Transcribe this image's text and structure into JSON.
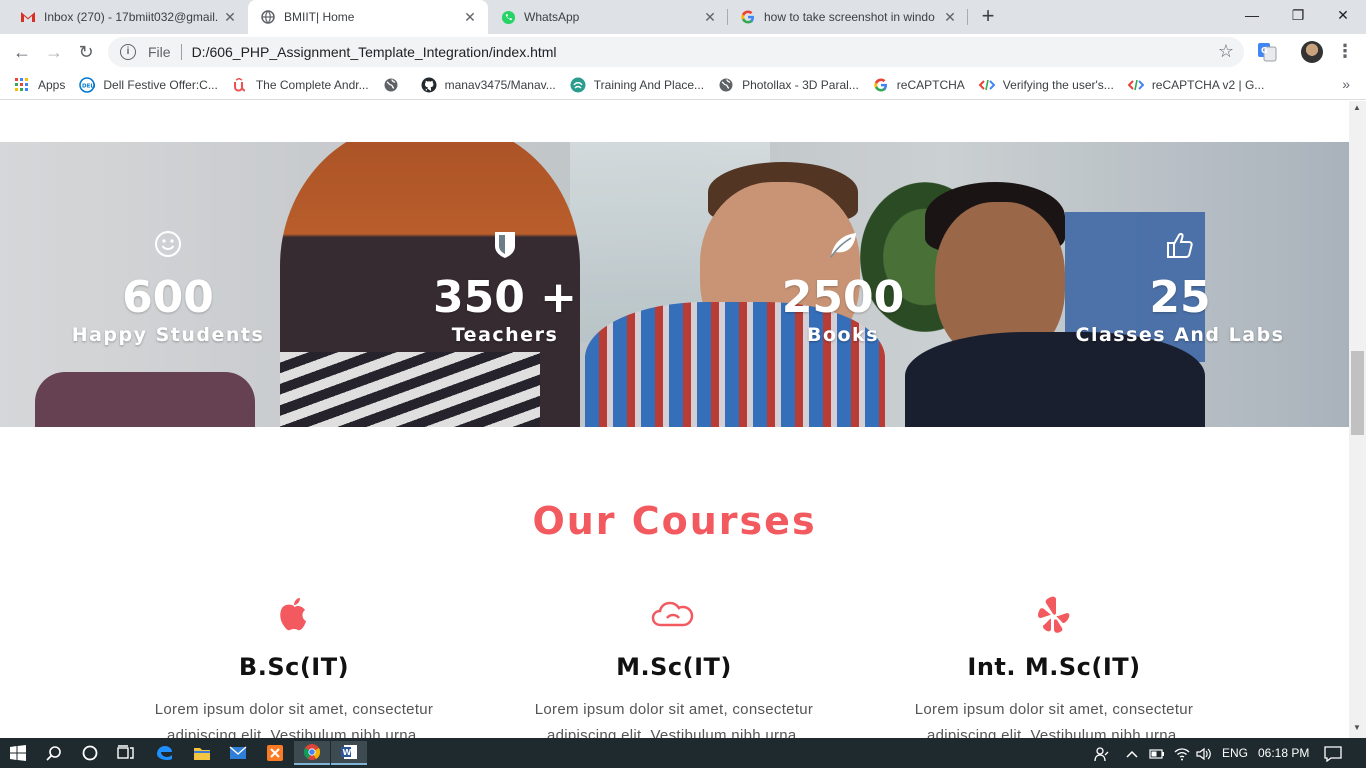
{
  "browser": {
    "tabs": [
      {
        "title": "Inbox (270) - 17bmiit032@gmail.",
        "favicon": "gmail-icon"
      },
      {
        "title": "BMIIT| Home",
        "favicon": "globe-icon",
        "active": true
      },
      {
        "title": "WhatsApp",
        "favicon": "whatsapp-icon"
      },
      {
        "title": "how to take screenshot in windo",
        "favicon": "google-icon"
      }
    ],
    "new_tab": "+",
    "url_scheme": "File",
    "url": "D:/606_PHP_Assignment_Template_Integration/index.html"
  },
  "bookmarks": [
    {
      "label": "Apps",
      "icon": "apps-grid-icon"
    },
    {
      "label": "Dell Festive Offer:C...",
      "icon": "dell-icon"
    },
    {
      "label": "The Complete Andr...",
      "icon": "udemy-icon"
    },
    {
      "label": "",
      "icon": "globe-icon"
    },
    {
      "label": "manav3475/Manav...",
      "icon": "github-icon"
    },
    {
      "label": "Training And Place...",
      "icon": "placement-icon"
    },
    {
      "label": "Photollax - 3D Paral...",
      "icon": "globe-icon"
    },
    {
      "label": "reCAPTCHA",
      "icon": "google-icon"
    },
    {
      "label": "Verifying the user's...",
      "icon": "code-icon"
    },
    {
      "label": "reCAPTCHA v2 | G...",
      "icon": "code-icon"
    }
  ],
  "stats": [
    {
      "value": "600",
      "label": "Happy Students",
      "icon": "smile-icon"
    },
    {
      "value": "350 +",
      "label": "Teachers",
      "icon": "shield-icon"
    },
    {
      "value": "2500",
      "label": "Books",
      "icon": "leaf-icon"
    },
    {
      "value": "25",
      "label": "Classes And Labs",
      "icon": "thumbs-up-icon"
    }
  ],
  "courses": {
    "title": "Our Courses",
    "items": [
      {
        "name": "B.Sc(IT)",
        "icon": "apple-icon",
        "desc_line1": "Lorem ipsum dolor sit amet, consectetur",
        "desc_line2": "adipiscing elit. Vestibulum nibh urna,"
      },
      {
        "name": "M.Sc(IT)",
        "icon": "cloud-icon",
        "desc_line1": "Lorem ipsum dolor sit amet, consectetur",
        "desc_line2": "adipiscing elit. Vestibulum nibh urna,"
      },
      {
        "name": "Int. M.Sc(IT)",
        "icon": "yelp-icon",
        "desc_line1": "Lorem ipsum dolor sit amet, consectetur",
        "desc_line2": "adipiscing elit. Vestibulum nibh urna,"
      }
    ]
  },
  "taskbar": {
    "language": "ENG",
    "time": "06:18 PM"
  },
  "colors": {
    "accent": "#f25a5f",
    "taskbar": "#1f2a2f"
  }
}
